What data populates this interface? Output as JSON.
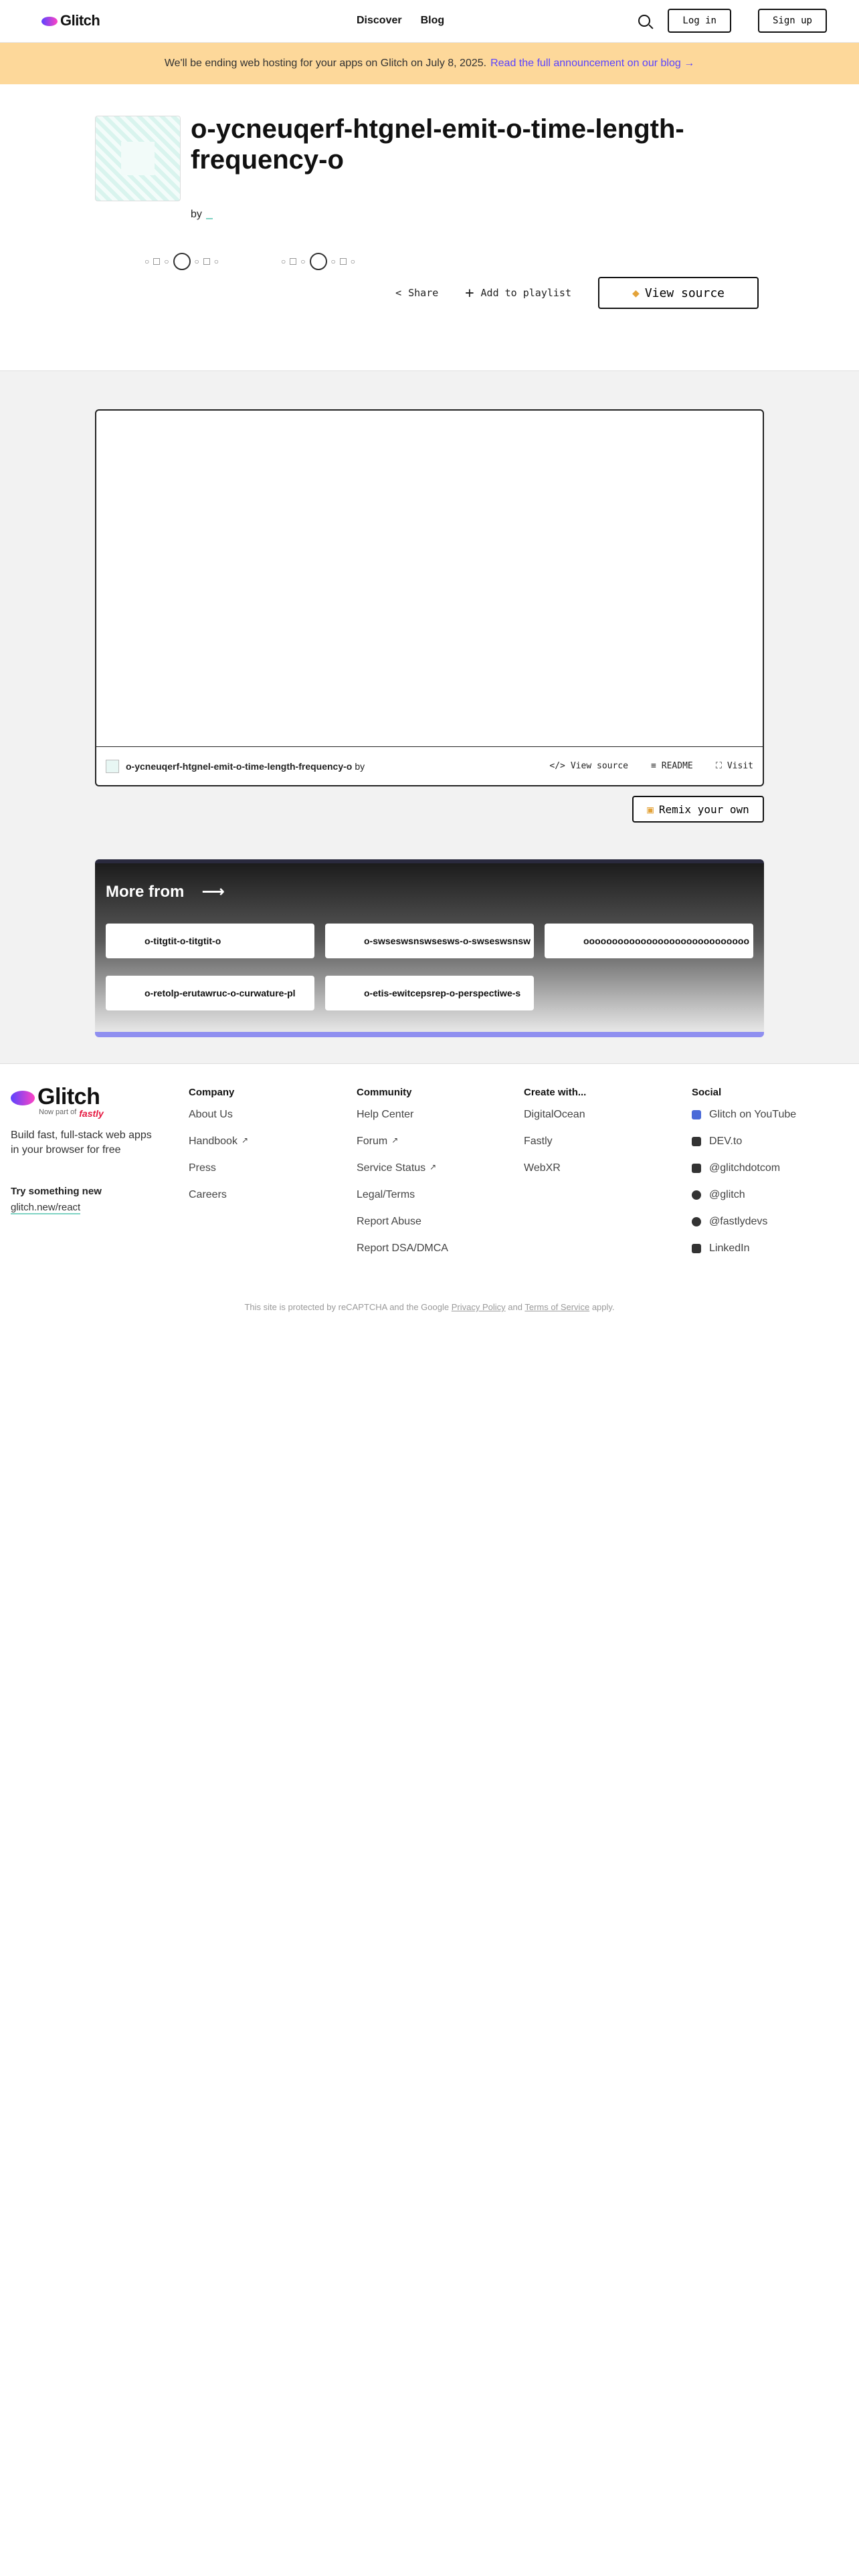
{
  "header": {
    "brand": "Glitch",
    "nav": [
      "Discover",
      "Blog"
    ],
    "login": "Log in",
    "signup": "Sign up"
  },
  "banner": {
    "text": "We'll be ending web hosting for your apps on Glitch on July 8, 2025.",
    "link": "Read the full announcement on our blog →"
  },
  "project": {
    "title": "o-ycneuqerf-htgnel-emit-o-time-length-frequency-o",
    "by": "by",
    "share": "Share",
    "add_playlist": "Add to playlist",
    "view_source": "View source"
  },
  "embed": {
    "name": "o-ycneuqerf-htgnel-emit-o-time-length-frequency-o",
    "by": "by",
    "view_source": "View source",
    "readme": "README",
    "visit": "Visit",
    "remix": "Remix your own"
  },
  "more": {
    "title": "More from",
    "cards": [
      "o-titgtit-o-titgtit-o",
      "o-swseswsnswsesws-o-swseswsnsw",
      "ooooooooooooooooooooooooooooo",
      "o-retolp-erutawruc-o-curwature-pl",
      "o-etis-ewitcepsrep-o-perspectiwe-s"
    ]
  },
  "footer": {
    "brand": "Glitch",
    "partner_prefix": "Now part of",
    "partner": "fastly",
    "tagline": "Build fast, full-stack web apps in your browser for free",
    "try_title": "Try something new",
    "try_link": "glitch.new/react",
    "company": {
      "title": "Company",
      "items": [
        "About Us",
        "Handbook",
        "Press",
        "Careers"
      ]
    },
    "community": {
      "title": "Community",
      "items": [
        "Help Center",
        "Forum",
        "Service Status",
        "Legal/Terms",
        "Report Abuse",
        "Report DSA/DMCA"
      ]
    },
    "create": {
      "title": "Create with...",
      "items": [
        "DigitalOcean",
        "Fastly",
        "WebXR"
      ]
    },
    "social": {
      "title": "Social",
      "items": [
        "Glitch on YouTube",
        "DEV.to",
        "@glitchdotcom",
        "@glitch",
        "@fastlydevs",
        "LinkedIn"
      ]
    }
  },
  "legal": {
    "prefix": "This site is protected by reCAPTCHA and the Google",
    "privacy": "Privacy Policy",
    "and": "and",
    "terms": "Terms of Service",
    "suffix": "apply."
  }
}
